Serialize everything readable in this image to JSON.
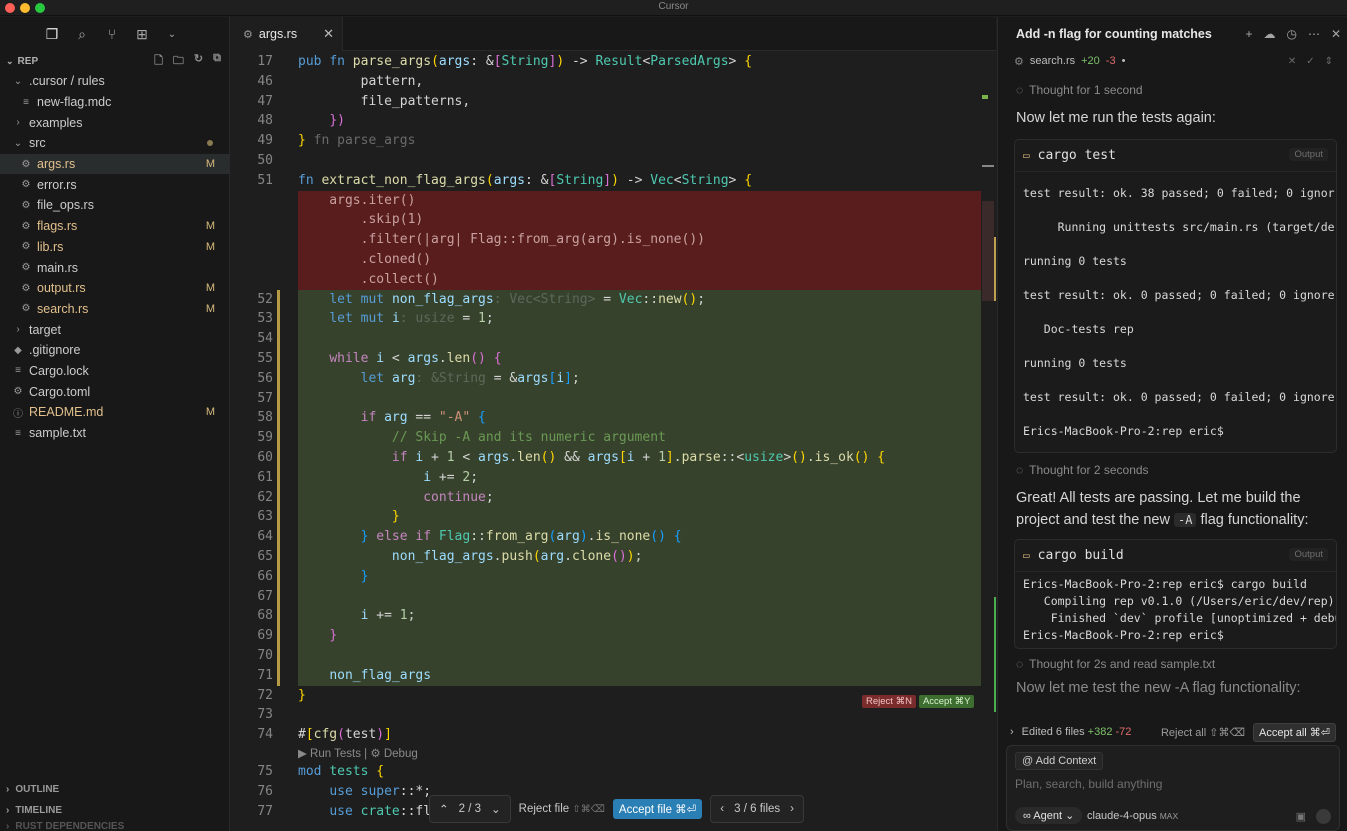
{
  "window": {
    "title": "Cursor"
  },
  "sidebar": {
    "section_title": "REP",
    "tree": [
      {
        "label": ".cursor / rules",
        "icon": "chevron-down",
        "indent": 1,
        "mod": "",
        "type": "folder"
      },
      {
        "label": "new-flag.mdc",
        "icon": "file-lines",
        "indent": 2,
        "mod": "",
        "type": "file"
      },
      {
        "label": "examples",
        "icon": "chevron-right",
        "indent": 1,
        "mod": "",
        "type": "folder"
      },
      {
        "label": "src",
        "icon": "chevron-down",
        "indent": 1,
        "mod": "",
        "type": "folder",
        "dot": true
      },
      {
        "label": "args.rs",
        "icon": "rust",
        "indent": 2,
        "mod": "M",
        "type": "file",
        "selected": true
      },
      {
        "label": "error.rs",
        "icon": "rust",
        "indent": 2,
        "mod": "",
        "type": "file"
      },
      {
        "label": "file_ops.rs",
        "icon": "rust",
        "indent": 2,
        "mod": "",
        "type": "file"
      },
      {
        "label": "flags.rs",
        "icon": "rust",
        "indent": 2,
        "mod": "M",
        "type": "file"
      },
      {
        "label": "lib.rs",
        "icon": "rust",
        "indent": 2,
        "mod": "M",
        "type": "file"
      },
      {
        "label": "main.rs",
        "icon": "rust",
        "indent": 2,
        "mod": "",
        "type": "file"
      },
      {
        "label": "output.rs",
        "icon": "rust",
        "indent": 2,
        "mod": "M",
        "type": "file"
      },
      {
        "label": "search.rs",
        "icon": "rust",
        "indent": 2,
        "mod": "M",
        "type": "file"
      },
      {
        "label": "target",
        "icon": "chevron-right",
        "indent": 1,
        "mod": "",
        "type": "folder"
      },
      {
        "label": ".gitignore",
        "icon": "git",
        "indent": 1,
        "mod": "",
        "type": "file"
      },
      {
        "label": "Cargo.lock",
        "icon": "file-lines",
        "indent": 1,
        "mod": "",
        "type": "file"
      },
      {
        "label": "Cargo.toml",
        "icon": "gear",
        "indent": 1,
        "mod": "",
        "type": "file"
      },
      {
        "label": "README.md",
        "icon": "info",
        "indent": 1,
        "mod": "M",
        "type": "file"
      },
      {
        "label": "sample.txt",
        "icon": "file-lines",
        "indent": 1,
        "mod": "",
        "type": "file"
      }
    ],
    "bottom_sections": [
      "OUTLINE",
      "TIMELINE",
      "RUST DEPENDENCIES"
    ]
  },
  "editor": {
    "tab_label": "args.rs",
    "lines": [
      {
        "n": "17",
        "html": "<span style='color:#569cd6'>pub</span> <span style='color:#569cd6'>fn</span> <span style='color:#dcdcaa'>parse_args</span><span style='color:#ffd700'>(</span><span style='color:#9cdcfe'>args</span>: &amp;<span style='color:#da70d6'>[</span><span style='color:#4ec9b0'>String</span><span style='color:#da70d6'>]</span><span style='color:#ffd700'>)</span> -&gt; <span style='color:#4ec9b0'>Result</span>&lt;<span style='color:#4ec9b0'>ParsedArgs</span>&gt; <span style='color:#ffd700'>{</span>",
        "kind": ""
      },
      {
        "n": "46",
        "html": "        pattern,",
        "kind": ""
      },
      {
        "n": "47",
        "html": "        file_patterns,",
        "kind": ""
      },
      {
        "n": "48",
        "html": "    <span style='color:#da70d6'>})</span>",
        "kind": ""
      },
      {
        "n": "49",
        "html": "<span style='color:#ffd700'>}</span> <span style='color:#6a6a6a'>fn parse_args</span>",
        "kind": ""
      },
      {
        "n": "50",
        "html": "",
        "kind": ""
      },
      {
        "n": "51",
        "html": "<span style='color:#569cd6'>fn</span> <span style='color:#dcdcaa'>extract_non_flag_args</span><span style='color:#ffd700'>(</span><span style='color:#9cdcfe'>args</span>: &amp;<span style='color:#da70d6'>[</span><span style='color:#4ec9b0'>String</span><span style='color:#da70d6'>]</span><span style='color:#ffd700'>)</span> -&gt; <span style='color:#4ec9b0'>Vec</span>&lt;<span style='color:#4ec9b0'>String</span>&gt; <span style='color:#ffd700'>{</span>",
        "kind": ""
      },
      {
        "n": "",
        "html": "    args.iter()",
        "kind": "del"
      },
      {
        "n": "",
        "html": "        .skip(1)",
        "kind": "del"
      },
      {
        "n": "",
        "html": "        .filter(|arg| Flag::from_arg(arg).is_none())",
        "kind": "del"
      },
      {
        "n": "",
        "html": "        .cloned()",
        "kind": "del"
      },
      {
        "n": "",
        "html": "        .collect()",
        "kind": "del"
      },
      {
        "n": "52",
        "html": "    <span style='color:#569cd6'>let</span> <span style='color:#569cd6'>mut</span> <span style='color:#9cdcfe'>non_flag_args</span><span style='color:#5a6a5a'>: Vec&lt;String&gt;</span> = <span style='color:#4ec9b0'>Vec</span>::<span style='color:#dcdcaa'>new</span><span style='color:#ffd700'>()</span>;",
        "kind": "add"
      },
      {
        "n": "53",
        "html": "    <span style='color:#569cd6'>let</span> <span style='color:#569cd6'>mut</span> <span style='color:#9cdcfe'>i</span><span style='color:#5a6a5a'>: usize</span> = <span style='color:#b5cea8'>1</span>;",
        "kind": "add"
      },
      {
        "n": "54",
        "html": "",
        "kind": "add"
      },
      {
        "n": "55",
        "html": "    <span style='color:#c586c0'>while</span> <span style='color:#9cdcfe'>i</span> &lt; <span style='color:#9cdcfe'>args</span>.<span style='color:#dcdcaa'>len</span><span style='color:#da70d6'>()</span> <span style='color:#da70d6'>{</span>",
        "kind": "add"
      },
      {
        "n": "56",
        "html": "        <span style='color:#569cd6'>let</span> <span style='color:#9cdcfe'>arg</span><span style='color:#5a6a5a'>: &amp;String</span> = &amp;<span style='color:#9cdcfe'>args</span><span style='color:#179fff'>[</span><span style='color:#9cdcfe'>i</span><span style='color:#179fff'>]</span>;",
        "kind": "add"
      },
      {
        "n": "57",
        "html": "",
        "kind": "add"
      },
      {
        "n": "58",
        "html": "        <span style='color:#c586c0'>if</span> <span style='color:#9cdcfe'>arg</span> == <span style='color:#ce9178'>\"-A\"</span> <span style='color:#179fff'>{</span>",
        "kind": "add"
      },
      {
        "n": "59",
        "html": "            <span style='color:#6a9955'>// Skip -A and its numeric argument</span>",
        "kind": "add"
      },
      {
        "n": "60",
        "html": "            <span style='color:#c586c0'>if</span> <span style='color:#9cdcfe'>i</span> + <span style='color:#b5cea8'>1</span> &lt; <span style='color:#9cdcfe'>args</span>.<span style='color:#dcdcaa'>len</span><span style='color:#ffd700'>()</span> &amp;&amp; <span style='color:#9cdcfe'>args</span><span style='color:#ffd700'>[</span><span style='color:#9cdcfe'>i</span> + <span style='color:#b5cea8'>1</span><span style='color:#ffd700'>]</span>.<span style='color:#dcdcaa'>parse</span>::&lt;<span style='color:#4ec9b0'>usize</span>&gt;<span style='color:#ffd700'>()</span>.<span style='color:#dcdcaa'>is_ok</span><span style='color:#ffd700'>()</span> <span style='color:#ffd700'>{</span>",
        "kind": "add"
      },
      {
        "n": "61",
        "html": "                <span style='color:#9cdcfe'>i</span> += <span style='color:#b5cea8'>2</span>;",
        "kind": "add"
      },
      {
        "n": "62",
        "html": "                <span style='color:#c586c0'>continue</span>;",
        "kind": "add"
      },
      {
        "n": "63",
        "html": "            <span style='color:#ffd700'>}</span>",
        "kind": "add"
      },
      {
        "n": "64",
        "html": "        <span style='color:#179fff'>}</span> <span style='color:#c586c0'>else</span> <span style='color:#c586c0'>if</span> <span style='color:#4ec9b0'>Flag</span>::<span style='color:#dcdcaa'>from_arg</span><span style='color:#179fff'>(</span><span style='color:#9cdcfe'>arg</span><span style='color:#179fff'>)</span>.<span style='color:#dcdcaa'>is_none</span><span style='color:#179fff'>()</span> <span style='color:#179fff'>{</span>",
        "kind": "add"
      },
      {
        "n": "65",
        "html": "            <span style='color:#9cdcfe'>non_flag_args</span>.<span style='color:#dcdcaa'>push</span><span style='color:#ffd700'>(</span><span style='color:#9cdcfe'>arg</span>.<span style='color:#dcdcaa'>clone</span><span style='color:#da70d6'>()</span><span style='color:#ffd700'>)</span>;",
        "kind": "add"
      },
      {
        "n": "66",
        "html": "        <span style='color:#179fff'>}</span>",
        "kind": "add"
      },
      {
        "n": "67",
        "html": "",
        "kind": "add"
      },
      {
        "n": "68",
        "html": "        <span style='color:#9cdcfe'>i</span> += <span style='color:#b5cea8'>1</span>;",
        "kind": "add"
      },
      {
        "n": "69",
        "html": "    <span style='color:#da70d6'>}</span>",
        "kind": "add"
      },
      {
        "n": "70",
        "html": "",
        "kind": "add"
      },
      {
        "n": "71",
        "html": "    <span style='color:#9cdcfe'>non_flag_args</span>",
        "kind": "add"
      },
      {
        "n": "72",
        "html": "<span style='color:#ffd700'>}</span>",
        "kind": ""
      },
      {
        "n": "73",
        "html": "",
        "kind": ""
      },
      {
        "n": "74",
        "html": "#<span style='color:#ffd700'>[</span><span style='color:#dcdcaa'>cfg</span><span style='color:#da70d6'>(</span>test<span style='color:#da70d6'>)</span><span style='color:#ffd700'>]</span>",
        "kind": ""
      },
      {
        "n": "",
        "html": "<span style='color:#8a8a8a;font-family:Liberation Sans,sans-serif;font-size:11.5px'>▶ Run Tests | ⚙ Debug</span>",
        "kind": "lens"
      },
      {
        "n": "75",
        "html": "<span style='color:#569cd6'>mod</span> <span style='color:#4ec9b0'>tests</span> <span style='color:#ffd700'>{</span>",
        "kind": ""
      },
      {
        "n": "76",
        "html": "    <span style='color:#569cd6'>use</span> <span style='color:#569cd6'>super</span>::*;",
        "kind": ""
      },
      {
        "n": "77",
        "html": "    <span style='color:#569cd6'>use</span> <span style='color:#4ec9b0'>crate</span>::flags::Flag;",
        "kind": ""
      }
    ],
    "hunk_reject": "Reject ⌘N",
    "hunk_accept": "Accept ⌘Y",
    "nav_count": "2 / 3",
    "reject_file": "Reject file",
    "reject_shortcut": "⇧⌘⌫",
    "accept_file": "Accept file ⌘⏎",
    "files_count": "3 / 6 files"
  },
  "panel": {
    "title": "Add -n flag for counting matches",
    "file_chip": {
      "name": "search.rs",
      "plus": "+20",
      "minus": "-3"
    },
    "thought1": "Thought for 1 second",
    "msg1": "Now let me run the tests again:",
    "term1": {
      "cmd": "cargo test",
      "output_label": "Output",
      "lines": [
        "test result: ok. 38 passed; 0 failed; 0 ignor",
        "     Running unittests src/main.rs (target/de",
        "running 0 tests",
        "test result: ok. 0 passed; 0 failed; 0 ignore",
        "   Doc-tests rep",
        "running 0 tests",
        "test result: ok. 0 passed; 0 failed; 0 ignore",
        "Erics-MacBook-Pro-2:rep eric$"
      ]
    },
    "thought2": "Thought for 2 seconds",
    "msg2_a": "Great! All tests are passing. Let me build the project and test the new ",
    "msg2_code": "-A",
    "msg2_b": " flag functionality:",
    "term2": {
      "cmd": "cargo build",
      "output_label": "Output",
      "lines": [
        "Erics-MacBook-Pro-2:rep eric$ cargo build",
        "   Compiling rep v0.1.0 (/Users/eric/dev/rep)",
        "    Finished `dev` profile [unoptimized + debu",
        "Erics-MacBook-Pro-2:rep eric$"
      ]
    },
    "thought3": "Thought for 2s and read sample.txt",
    "msg3": "Now let me test the new -A flag functionality:",
    "edited": {
      "label": "Edited 6 files",
      "plus": "+382",
      "minus": "-72",
      "reject_all": "Reject all ⇧⌘⌫",
      "accept_all": "Accept all ⌘⏎"
    },
    "composer": {
      "add_context": "Add Context",
      "placeholder": "Plan, search, build anything",
      "agent": "Agent",
      "model": "claude-4-opus",
      "max": "MAX"
    }
  }
}
